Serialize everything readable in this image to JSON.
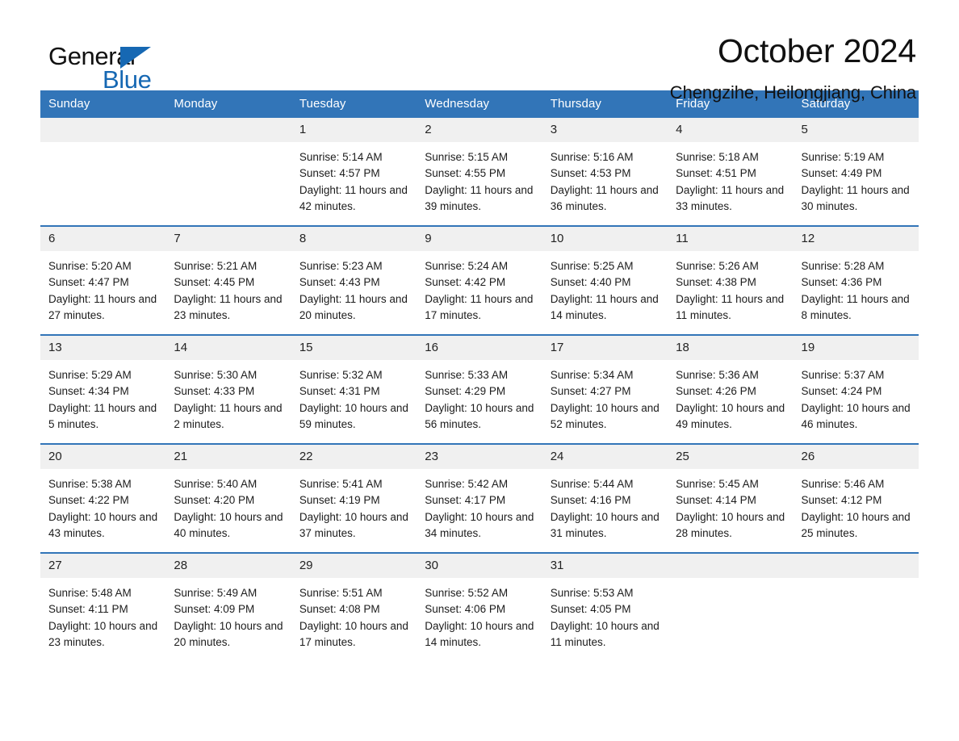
{
  "brand": {
    "name_part1": "General",
    "name_part2": "Blue",
    "accent_color": "#1668b3",
    "triangle_icon": "blue-triangle-icon"
  },
  "header": {
    "title": "October 2024",
    "subtitle": "Chengzihe, Heilongjiang, China"
  },
  "calendar": {
    "header_bg": "#3275b8",
    "daynum_bg": "#f0f0f0",
    "weekday_headers": [
      "Sunday",
      "Monday",
      "Tuesday",
      "Wednesday",
      "Thursday",
      "Friday",
      "Saturday"
    ],
    "labels": {
      "sunrise_prefix": "Sunrise:",
      "sunset_prefix": "Sunset:",
      "daylight_prefix": "Daylight:"
    },
    "weeks": [
      [
        {
          "day": "",
          "empty": true
        },
        {
          "day": "",
          "empty": true
        },
        {
          "day": "1",
          "sunrise": "Sunrise: 5:14 AM",
          "sunset": "Sunset: 4:57 PM",
          "daylight": "Daylight: 11 hours and 42 minutes."
        },
        {
          "day": "2",
          "sunrise": "Sunrise: 5:15 AM",
          "sunset": "Sunset: 4:55 PM",
          "daylight": "Daylight: 11 hours and 39 minutes."
        },
        {
          "day": "3",
          "sunrise": "Sunrise: 5:16 AM",
          "sunset": "Sunset: 4:53 PM",
          "daylight": "Daylight: 11 hours and 36 minutes."
        },
        {
          "day": "4",
          "sunrise": "Sunrise: 5:18 AM",
          "sunset": "Sunset: 4:51 PM",
          "daylight": "Daylight: 11 hours and 33 minutes."
        },
        {
          "day": "5",
          "sunrise": "Sunrise: 5:19 AM",
          "sunset": "Sunset: 4:49 PM",
          "daylight": "Daylight: 11 hours and 30 minutes."
        }
      ],
      [
        {
          "day": "6",
          "sunrise": "Sunrise: 5:20 AM",
          "sunset": "Sunset: 4:47 PM",
          "daylight": "Daylight: 11 hours and 27 minutes."
        },
        {
          "day": "7",
          "sunrise": "Sunrise: 5:21 AM",
          "sunset": "Sunset: 4:45 PM",
          "daylight": "Daylight: 11 hours and 23 minutes."
        },
        {
          "day": "8",
          "sunrise": "Sunrise: 5:23 AM",
          "sunset": "Sunset: 4:43 PM",
          "daylight": "Daylight: 11 hours and 20 minutes."
        },
        {
          "day": "9",
          "sunrise": "Sunrise: 5:24 AM",
          "sunset": "Sunset: 4:42 PM",
          "daylight": "Daylight: 11 hours and 17 minutes."
        },
        {
          "day": "10",
          "sunrise": "Sunrise: 5:25 AM",
          "sunset": "Sunset: 4:40 PM",
          "daylight": "Daylight: 11 hours and 14 minutes."
        },
        {
          "day": "11",
          "sunrise": "Sunrise: 5:26 AM",
          "sunset": "Sunset: 4:38 PM",
          "daylight": "Daylight: 11 hours and 11 minutes."
        },
        {
          "day": "12",
          "sunrise": "Sunrise: 5:28 AM",
          "sunset": "Sunset: 4:36 PM",
          "daylight": "Daylight: 11 hours and 8 minutes."
        }
      ],
      [
        {
          "day": "13",
          "sunrise": "Sunrise: 5:29 AM",
          "sunset": "Sunset: 4:34 PM",
          "daylight": "Daylight: 11 hours and 5 minutes."
        },
        {
          "day": "14",
          "sunrise": "Sunrise: 5:30 AM",
          "sunset": "Sunset: 4:33 PM",
          "daylight": "Daylight: 11 hours and 2 minutes."
        },
        {
          "day": "15",
          "sunrise": "Sunrise: 5:32 AM",
          "sunset": "Sunset: 4:31 PM",
          "daylight": "Daylight: 10 hours and 59 minutes."
        },
        {
          "day": "16",
          "sunrise": "Sunrise: 5:33 AM",
          "sunset": "Sunset: 4:29 PM",
          "daylight": "Daylight: 10 hours and 56 minutes."
        },
        {
          "day": "17",
          "sunrise": "Sunrise: 5:34 AM",
          "sunset": "Sunset: 4:27 PM",
          "daylight": "Daylight: 10 hours and 52 minutes."
        },
        {
          "day": "18",
          "sunrise": "Sunrise: 5:36 AM",
          "sunset": "Sunset: 4:26 PM",
          "daylight": "Daylight: 10 hours and 49 minutes."
        },
        {
          "day": "19",
          "sunrise": "Sunrise: 5:37 AM",
          "sunset": "Sunset: 4:24 PM",
          "daylight": "Daylight: 10 hours and 46 minutes."
        }
      ],
      [
        {
          "day": "20",
          "sunrise": "Sunrise: 5:38 AM",
          "sunset": "Sunset: 4:22 PM",
          "daylight": "Daylight: 10 hours and 43 minutes."
        },
        {
          "day": "21",
          "sunrise": "Sunrise: 5:40 AM",
          "sunset": "Sunset: 4:20 PM",
          "daylight": "Daylight: 10 hours and 40 minutes."
        },
        {
          "day": "22",
          "sunrise": "Sunrise: 5:41 AM",
          "sunset": "Sunset: 4:19 PM",
          "daylight": "Daylight: 10 hours and 37 minutes."
        },
        {
          "day": "23",
          "sunrise": "Sunrise: 5:42 AM",
          "sunset": "Sunset: 4:17 PM",
          "daylight": "Daylight: 10 hours and 34 minutes."
        },
        {
          "day": "24",
          "sunrise": "Sunrise: 5:44 AM",
          "sunset": "Sunset: 4:16 PM",
          "daylight": "Daylight: 10 hours and 31 minutes."
        },
        {
          "day": "25",
          "sunrise": "Sunrise: 5:45 AM",
          "sunset": "Sunset: 4:14 PM",
          "daylight": "Daylight: 10 hours and 28 minutes."
        },
        {
          "day": "26",
          "sunrise": "Sunrise: 5:46 AM",
          "sunset": "Sunset: 4:12 PM",
          "daylight": "Daylight: 10 hours and 25 minutes."
        }
      ],
      [
        {
          "day": "27",
          "sunrise": "Sunrise: 5:48 AM",
          "sunset": "Sunset: 4:11 PM",
          "daylight": "Daylight: 10 hours and 23 minutes."
        },
        {
          "day": "28",
          "sunrise": "Sunrise: 5:49 AM",
          "sunset": "Sunset: 4:09 PM",
          "daylight": "Daylight: 10 hours and 20 minutes."
        },
        {
          "day": "29",
          "sunrise": "Sunrise: 5:51 AM",
          "sunset": "Sunset: 4:08 PM",
          "daylight": "Daylight: 10 hours and 17 minutes."
        },
        {
          "day": "30",
          "sunrise": "Sunrise: 5:52 AM",
          "sunset": "Sunset: 4:06 PM",
          "daylight": "Daylight: 10 hours and 14 minutes."
        },
        {
          "day": "31",
          "sunrise": "Sunrise: 5:53 AM",
          "sunset": "Sunset: 4:05 PM",
          "daylight": "Daylight: 10 hours and 11 minutes."
        },
        {
          "day": "",
          "empty": true
        },
        {
          "day": "",
          "empty": true
        }
      ]
    ]
  }
}
